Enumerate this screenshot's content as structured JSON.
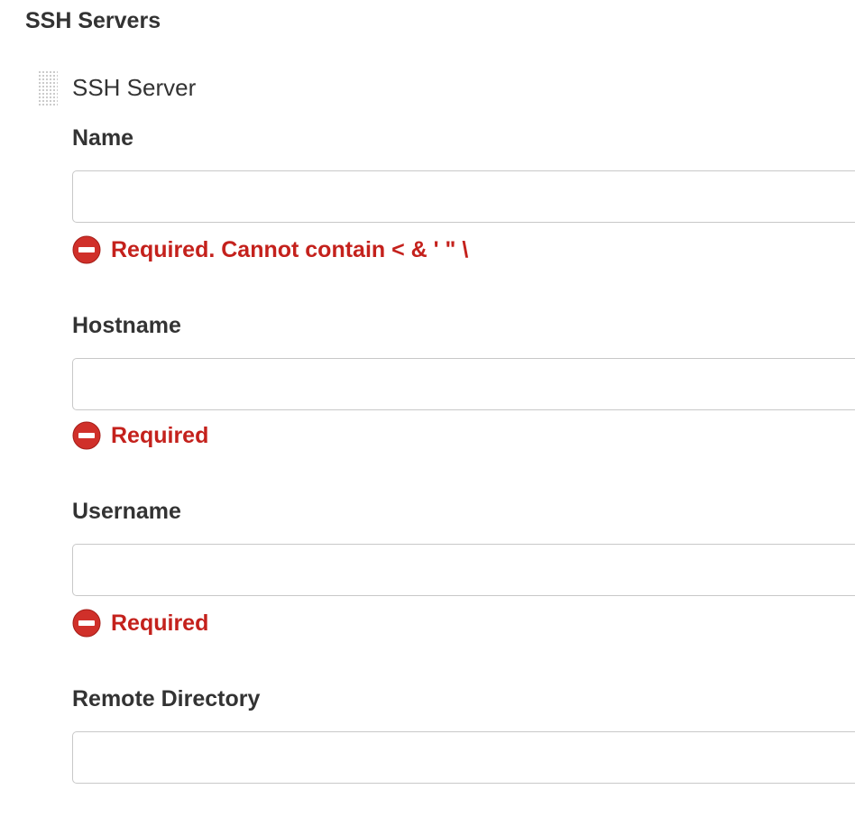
{
  "section": {
    "title": "SSH Servers"
  },
  "server": {
    "label": "SSH Server",
    "drag_handle_icon": "drag-handle-icon",
    "fields": {
      "name": {
        "label": "Name",
        "value": "",
        "error": "Required. Cannot contain < & ' \" \\"
      },
      "hostname": {
        "label": "Hostname",
        "value": "",
        "error": "Required"
      },
      "username": {
        "label": "Username",
        "value": "",
        "error": "Required"
      },
      "remote_directory": {
        "label": "Remote Directory",
        "value": ""
      }
    }
  },
  "colors": {
    "error": "#c4211c",
    "error_icon": "#d0302a",
    "input_border": "#c8c8c8",
    "text": "#333333"
  },
  "icons": {
    "error": "error-stop-icon"
  }
}
